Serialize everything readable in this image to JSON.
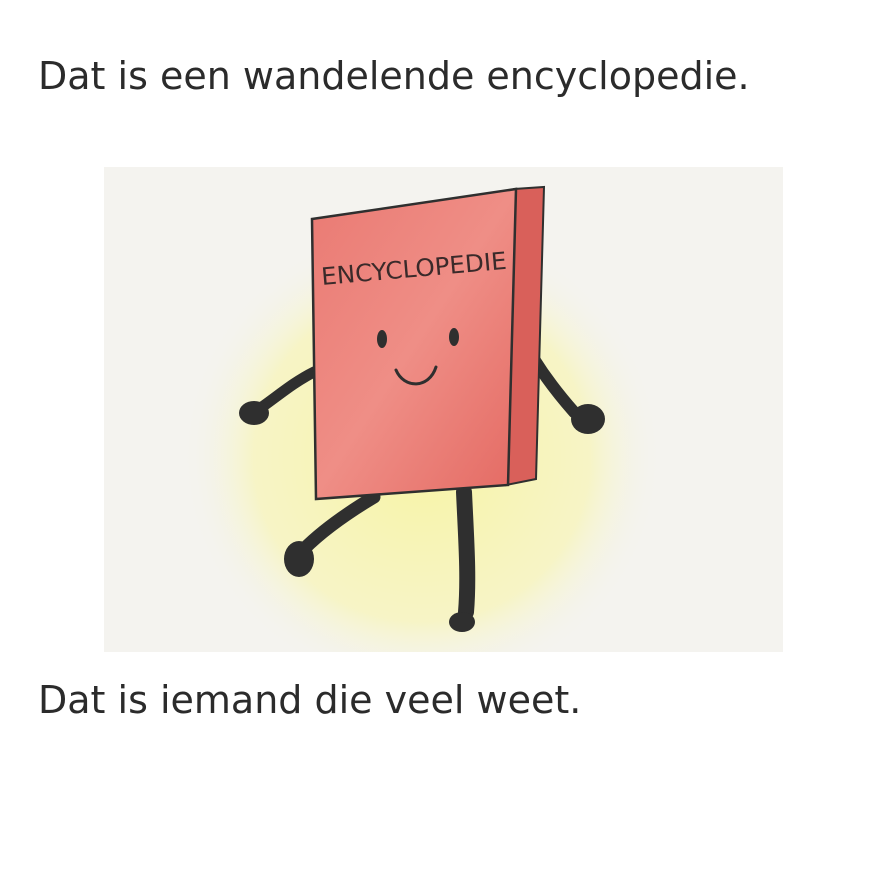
{
  "text": {
    "headline": "Dat is een wandelende encyclopedie.",
    "caption": "Dat is iemand die veel weet."
  },
  "illustration": {
    "book_cover_title": "ENCYCLOPEDIE"
  },
  "colors": {
    "text": "#2b2b2b",
    "book_red": "#e8736c",
    "book_spine": "#d9605a",
    "glow_yellow": "#f6f29a",
    "paper": "#f4f3ef",
    "limbs": "#2f2f2f"
  }
}
